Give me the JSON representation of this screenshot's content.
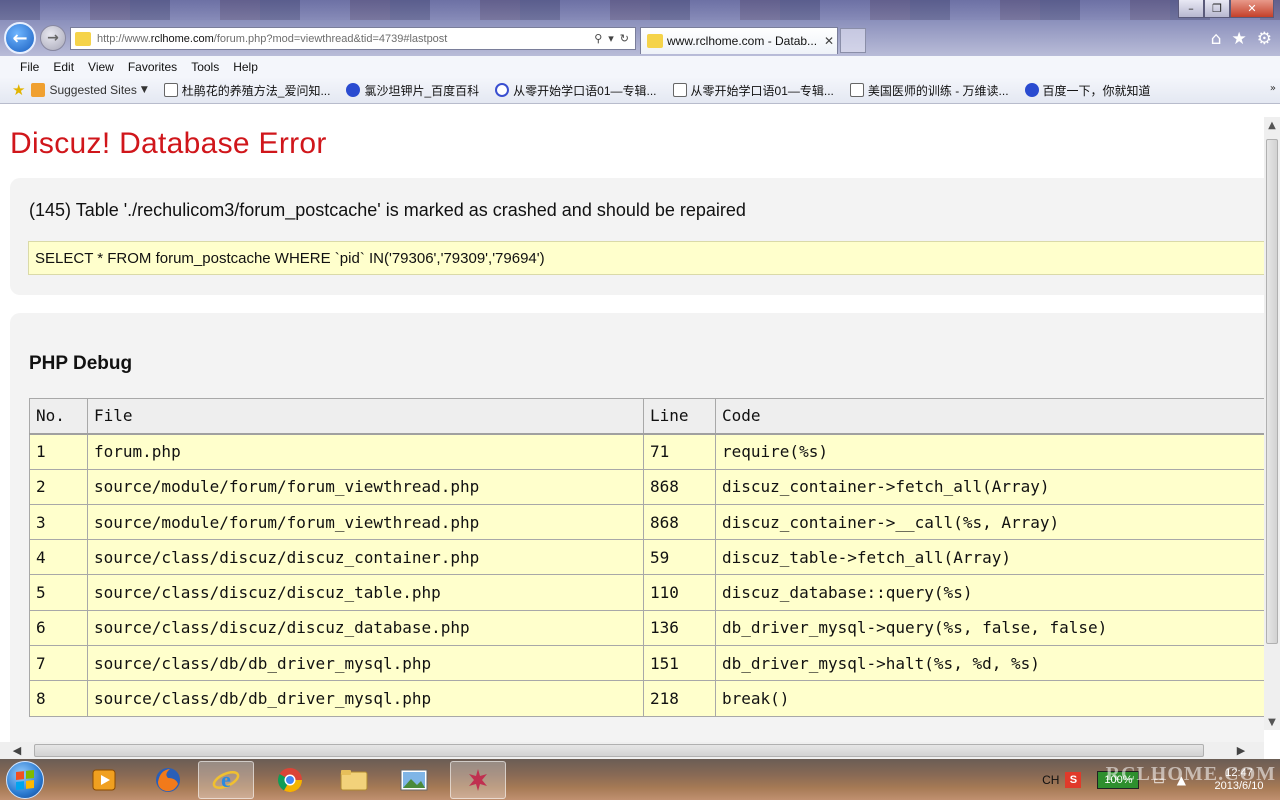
{
  "browser": {
    "address_url_prefix": "http://www.",
    "address_url_domain": "rclhome.com",
    "address_url_suffix": "/forum.php?mod=viewthread&tid=4739#lastpost",
    "tab_title": "www.rclhome.com - Datab...",
    "menu": [
      "File",
      "Edit",
      "View",
      "Favorites",
      "Tools",
      "Help"
    ],
    "favorites": [
      "Suggested Sites",
      "杜鹃花的养殖方法_爱问知...",
      "氯沙坦钾片_百度百科",
      "从零开始学口语01—专辑...",
      "从零开始学口语01—专辑...",
      "美国医师的训练 - 万维读...",
      "百度一下，你就知道"
    ]
  },
  "page": {
    "error_title": "Discuz! Database Error",
    "error_message": "(145) Table './rechulicom3/forum_postcache' is marked as crashed and should be repaired",
    "sql": "SELECT * FROM forum_postcache WHERE `pid` IN('79306','79309','79694')",
    "debug_title": "PHP Debug",
    "table": {
      "headers": [
        "No.",
        "File",
        "Line",
        "Code"
      ],
      "rows": [
        [
          "1",
          "forum.php",
          "71",
          "require(%s)"
        ],
        [
          "2",
          "source/module/forum/forum_viewthread.php",
          "868",
          "discuz_container->fetch_all(Array)"
        ],
        [
          "3",
          "source/module/forum/forum_viewthread.php",
          "868",
          "discuz_container->__call(%s, Array)"
        ],
        [
          "4",
          "source/class/discuz/discuz_container.php",
          "59",
          "discuz_table->fetch_all(Array)"
        ],
        [
          "5",
          "source/class/discuz/discuz_table.php",
          "110",
          "discuz_database::query(%s)"
        ],
        [
          "6",
          "source/class/discuz/discuz_database.php",
          "136",
          "db_driver_mysql->query(%s, false, false)"
        ],
        [
          "7",
          "source/class/db/db_driver_mysql.php",
          "151",
          "db_driver_mysql->halt(%s, %d, %s)"
        ],
        [
          "8",
          "source/class/db/db_driver_mysql.php",
          "218",
          "break()"
        ]
      ]
    }
  },
  "taskbar": {
    "ime_label": "CH",
    "ime_badge": "S",
    "battery": "100%",
    "time": "12:47",
    "date": "2013/6/10",
    "watermark": "RCLHOME.COM"
  },
  "colors": {
    "error_red": "#d0161b",
    "sql_bg": "#ffffcc",
    "panel_bg": "#f3f3f3"
  },
  "icons": [
    "back-arrow-icon",
    "forward-arrow-icon",
    "search-icon",
    "refresh-icon",
    "close-icon",
    "home-icon",
    "star-icon",
    "gear-icon",
    "windows-logo-icon",
    "media-player-icon",
    "firefox-icon",
    "ie-icon",
    "chrome-icon",
    "folder-icon",
    "picture-icon",
    "app-icon"
  ]
}
